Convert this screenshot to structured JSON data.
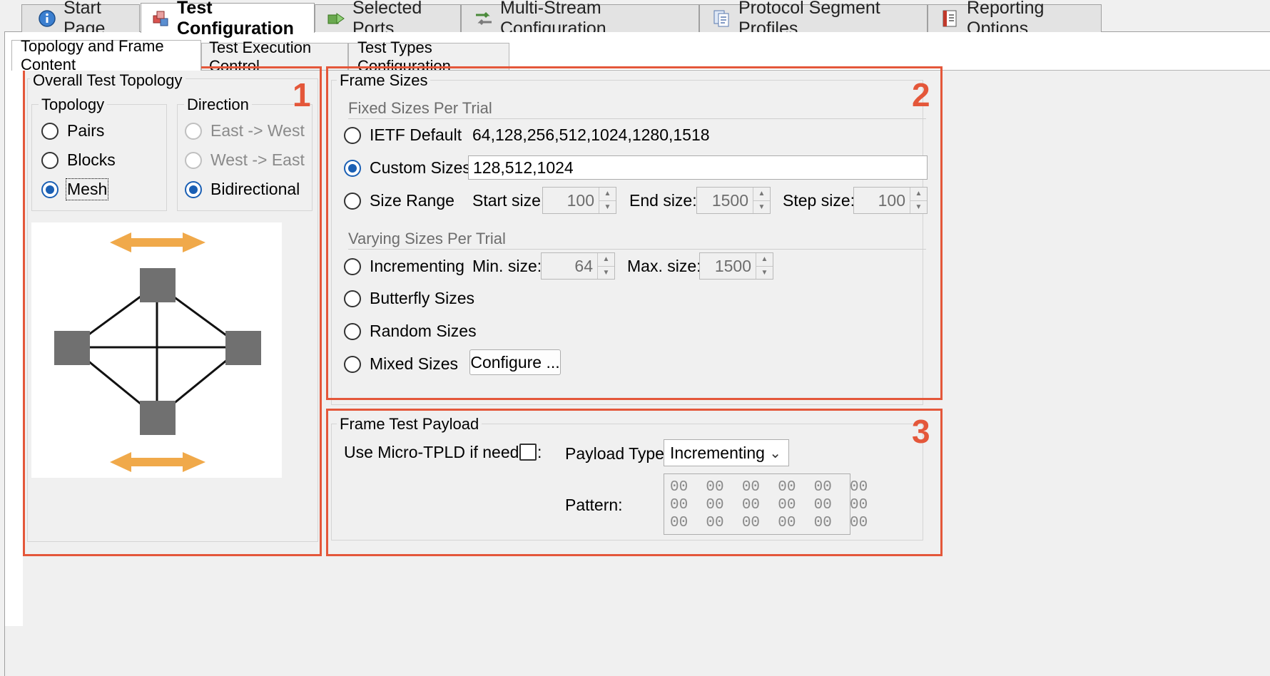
{
  "main_tabs": [
    {
      "label": "Start Page",
      "icon": "info-icon"
    },
    {
      "label": "Test Configuration",
      "icon": "cubes-icon",
      "active": true
    },
    {
      "label": "Selected Ports",
      "icon": "ports-icon"
    },
    {
      "label": "Multi-Stream Configuration",
      "icon": "streams-icon"
    },
    {
      "label": "Protocol Segment Profiles",
      "icon": "documents-icon"
    },
    {
      "label": "Reporting Options",
      "icon": "report-icon"
    }
  ],
  "sub_tabs": [
    {
      "label": "Topology and Frame Content",
      "active": true
    },
    {
      "label": "Test Execution Control"
    },
    {
      "label": "Test Types Configuration"
    }
  ],
  "topology_panel": {
    "title": "Overall Test Topology",
    "topology": {
      "title": "Topology",
      "options": [
        "Pairs",
        "Blocks",
        "Mesh"
      ],
      "selected": "Mesh"
    },
    "direction": {
      "title": "Direction",
      "options": [
        "East -> West",
        "West -> East",
        "Bidirectional"
      ],
      "selected": "Bidirectional"
    }
  },
  "frame_sizes": {
    "title": "Frame Sizes",
    "fixed_title": "Fixed Sizes Per Trial",
    "ietf_label": "IETF Default",
    "ietf_value": "64,128,256,512,1024,1280,1518",
    "custom_label": "Custom Sizes",
    "custom_value": "128,512,1024",
    "range_label": "Size Range",
    "start_label": "Start size:",
    "start_value": "100",
    "end_label": "End size:",
    "end_value": "1500",
    "step_label": "Step size:",
    "step_value": "100",
    "varying_title": "Varying Sizes Per Trial",
    "incrementing_label": "Incrementing",
    "min_label": "Min. size:",
    "min_value": "64",
    "max_label": "Max. size:",
    "max_value": "1500",
    "butterfly_label": "Butterfly Sizes",
    "random_label": "Random Sizes",
    "mixed_label": "Mixed Sizes",
    "configure_label": "Configure ...",
    "selected": "Custom Sizes"
  },
  "payload": {
    "title": "Frame Test Payload",
    "micro_tpld_label": "Use Micro-TPLD if needed:",
    "micro_tpld_checked": false,
    "type_label": "Payload Type:",
    "type_value": "Incrementing",
    "pattern_label": "Pattern:",
    "pattern_lines": [
      "00  00  00  00  00  00",
      "00  00  00  00  00  00",
      "00  00  00  00  00  00"
    ]
  },
  "annotations": [
    "1",
    "2",
    "3"
  ],
  "colors": {
    "annotation_red": "#e4573a",
    "radio_blue": "#1a5fb4",
    "arrow_orange": "#f0a94a",
    "node_gray": "#707070"
  }
}
